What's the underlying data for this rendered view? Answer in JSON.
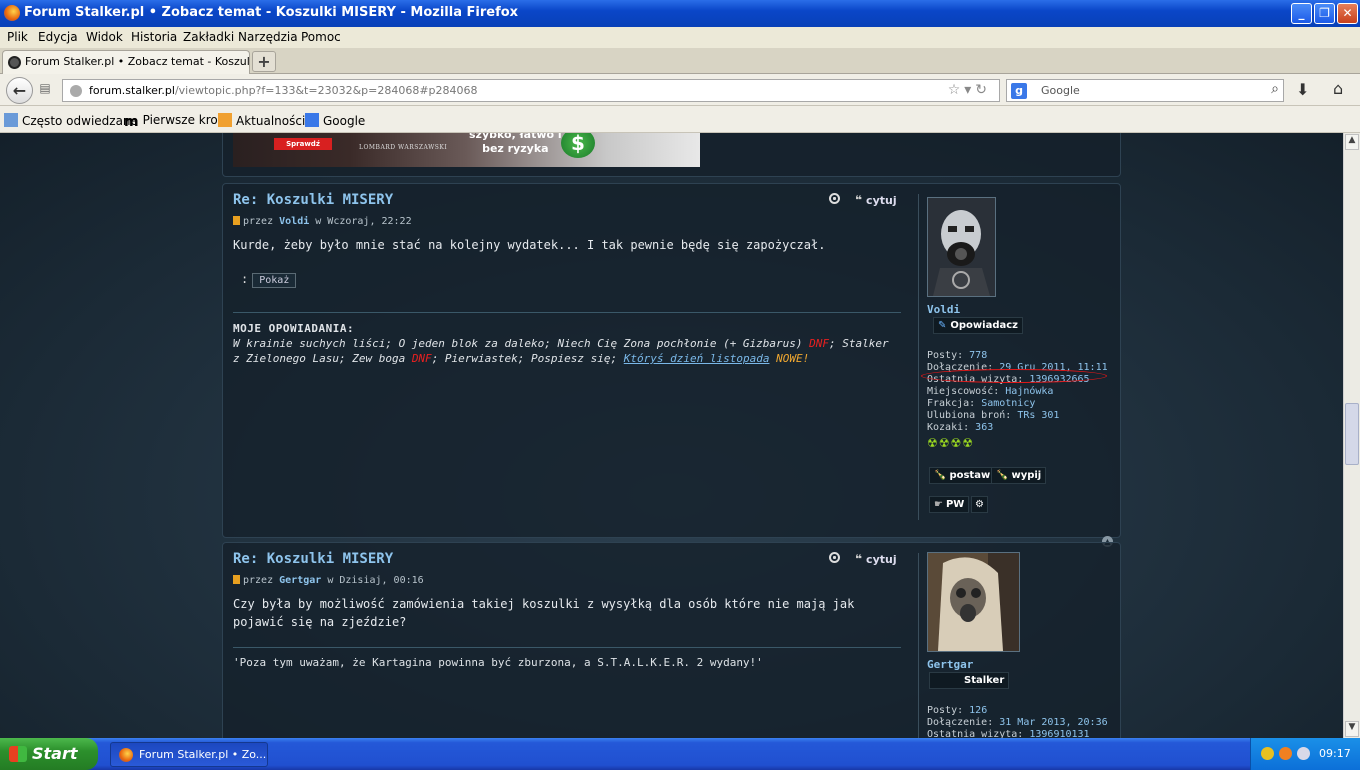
{
  "window": {
    "title": "Forum Stalker.pl • Zobacz temat - Koszulki MISERY - Mozilla Firefox",
    "minimize": "_",
    "maximize": "❐",
    "close": "✕"
  },
  "menu": [
    "Plik",
    "Edycja",
    "Widok",
    "Historia",
    "Zakładki",
    "Narzędzia",
    "Pomoc"
  ],
  "tab": {
    "label": "Forum Stalker.pl • Zobacz temat - Koszulki M...",
    "new_tab": "+"
  },
  "nav": {
    "url_host": "forum.stalker.pl",
    "url_path": "/viewtopic.php?f=133&t=23032&p=284068#p284068",
    "search_placeholder": "Google",
    "search_engine": "g"
  },
  "bookmarks": [
    "Często odwiedzane",
    "Pierwsze kroki",
    "Aktualności",
    "Google"
  ],
  "banner": {
    "cta": "Sprawdź",
    "brand": "LOMBARD WARSZAWSKI",
    "slogan_1": "szybko, łatwo i",
    "slogan_2": "bez ryzyka",
    "symbol": "$"
  },
  "posts": [
    {
      "title": "Re: Koszulki MISERY",
      "by": "przez",
      "author": "Voldi",
      "date": " w Wczoraj, 22:22",
      "quote_label": "cytuj",
      "body": "Kurde, żeby było mnie stać na kolejny wydatek... I tak pewnie będę się zapożyczał.",
      "spoiler_colon": ":",
      "spoiler_button": "Pokaż",
      "sig_heading": "MOJE OPOWIADANIA:",
      "sig_1": "W krainie suchych liści; O jeden blok za daleko; Niech Cię Zona pochłonie (+ Gizbarus) ",
      "sig_dnf1": "DNF",
      "sig_2": "; Stalker z Zielonego Lasu; Zew boga ",
      "sig_dnf2": "DNF",
      "sig_3": "; Pierwiastek; Pospiesz się; ",
      "sig_link": "Któryś dzień listopada",
      "sig_space": " ",
      "sig_new": "NOWE!",
      "profile": {
        "username": "Voldi",
        "rank": "Opowiadacz",
        "posts_label": "Posty: ",
        "posts": "778",
        "joined_label": "Dołączenie: ",
        "joined": "29 Gru 2011, 11:11",
        "last_visit_label": "Ostatnia wizyta: ",
        "last_visit": "1396932665",
        "location_label": "Miejscowość: ",
        "location": "Hajnówka",
        "faction_label": "Frakcja: ",
        "faction": "Samotnicy",
        "weapon_label": "Ulubiona broń: ",
        "weapon": "TRs 301",
        "kozaki_label": "Kozaki: ",
        "kozaki": "363",
        "radiation": "☢☢☢☢",
        "btn_postaw": "postaw",
        "btn_wypij": "wypij",
        "btn_pw": "PW"
      }
    },
    {
      "title": "Re: Koszulki MISERY",
      "by": "przez",
      "author": "Gertgar",
      "date": " w Dzisiaj, 00:16",
      "quote_label": "cytuj",
      "body": "Czy była by możliwość zamówienia takiej koszulki z wysyłką dla osób które nie mają jak pojawić się na zjeździe?",
      "signature": "'Poza tym uważam, że Kartagina powinna być zburzona, a S.T.A.L.K.E.R. 2 wydany!'",
      "profile": {
        "username": "Gertgar",
        "rank": "Stalker",
        "posts_label": "Posty: ",
        "posts": "126",
        "joined_label": "Dołączenie: ",
        "joined": "31 Mar 2013, 20:36",
        "last_visit_label": "Ostatnia wizyta: ",
        "last_visit": "1396910131"
      }
    }
  ],
  "taskbar": {
    "start": "Start",
    "item": "Forum Stalker.pl • Zo...",
    "clock": "09:17"
  },
  "colors": {
    "title_blue": "#8ec4ec",
    "dnf_red": "#e82020",
    "new_orange": "#f0a830"
  }
}
